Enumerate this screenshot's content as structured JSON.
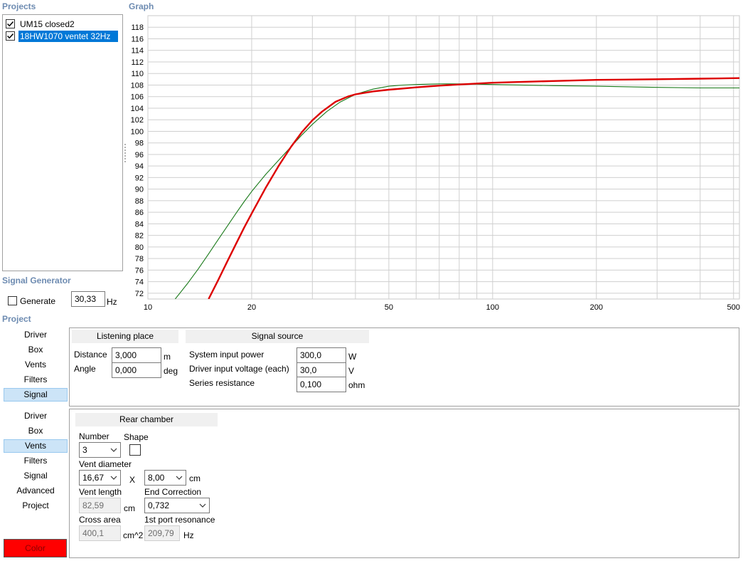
{
  "projects": {
    "title": "Projects",
    "items": [
      {
        "label": "UM15 closed2",
        "checked": true,
        "selected": false
      },
      {
        "label": "18HW1070 ventet 32Hz",
        "checked": true,
        "selected": true
      }
    ]
  },
  "graph": {
    "title": "Graph"
  },
  "signal_generator": {
    "title": "Signal Generator",
    "generate_label": "Generate",
    "generate_checked": false,
    "frequency": "30,33",
    "frequency_unit": "Hz"
  },
  "project": {
    "title": "Project",
    "nav1": [
      "Driver",
      "Box",
      "Vents",
      "Filters",
      "Signal"
    ],
    "nav1_active": "Signal",
    "nav2": [
      "Driver",
      "Box",
      "Vents",
      "Filters",
      "Signal",
      "Advanced",
      "Project"
    ],
    "nav2_active": "Vents",
    "color_button": "Color",
    "color_value": "#ff0000"
  },
  "listening_place": {
    "header": "Listening place",
    "distance_label": "Distance",
    "distance_value": "3,000",
    "distance_unit": "m",
    "angle_label": "Angle",
    "angle_value": "0,000",
    "angle_unit": "deg"
  },
  "signal_source": {
    "header": "Signal source",
    "power_label": "System input power",
    "power_value": "300,0",
    "power_unit": "W",
    "voltage_label": "Driver input voltage (each)",
    "voltage_value": "30,0",
    "voltage_unit": "V",
    "resistance_label": "Series resistance",
    "resistance_value": "0,100",
    "resistance_unit": "ohm"
  },
  "rear_chamber": {
    "header": "Rear chamber",
    "number_label": "Number",
    "number_value": "3",
    "shape_label": "Shape",
    "vent_diameter_label": "Vent diameter",
    "vent_diameter_1": "16,67",
    "x_label": "X",
    "vent_diameter_2": "8,00",
    "vent_diameter_unit": "cm",
    "vent_length_label": "Vent length",
    "vent_length_value": "82,59",
    "vent_length_unit": "cm",
    "end_correction_label": "End Correction",
    "end_correction_value": "0,732",
    "cross_area_label": "Cross area",
    "cross_area_value": "400,1",
    "cross_area_unit": "cm^2",
    "port_resonance_label": "1st port resonance",
    "port_resonance_value": "209,79",
    "port_resonance_unit": "Hz"
  },
  "chart_data": {
    "type": "line",
    "x_scale": "log",
    "xlim": [
      10,
      520
    ],
    "ylim": [
      71,
      120
    ],
    "grid": true,
    "x_ticks": [
      10,
      20,
      50,
      100,
      200,
      500
    ],
    "y_ticks": [
      72,
      74,
      76,
      78,
      80,
      82,
      84,
      86,
      88,
      90,
      92,
      94,
      96,
      98,
      100,
      102,
      104,
      106,
      108,
      110,
      112,
      114,
      116,
      118
    ],
    "series": [
      {
        "color": "#1a7a1a",
        "stroke": "thin",
        "x": [
          12,
          13,
          14,
          15,
          16,
          17,
          18,
          19,
          20,
          22,
          25,
          28,
          30,
          33,
          36,
          40,
          45,
          50,
          55,
          60,
          70,
          80,
          100,
          150,
          200,
          300,
          400,
          520
        ],
        "y": [
          71,
          73.6,
          76.2,
          78.8,
          81.3,
          83.6,
          85.8,
          87.8,
          89.6,
          92.6,
          96.2,
          99.4,
          101.2,
          103.4,
          105.0,
          106.4,
          107.3,
          107.8,
          108.0,
          108.1,
          108.2,
          108.2,
          108.1,
          107.9,
          107.8,
          107.6,
          107.5,
          107.5
        ]
      },
      {
        "color": "#dd0000",
        "stroke": "thick",
        "x": [
          15,
          16,
          17,
          18,
          19,
          20,
          22,
          24,
          26,
          28,
          30,
          32,
          35,
          38,
          40,
          45,
          50,
          55,
          60,
          70,
          80,
          100,
          150,
          200,
          300,
          400,
          520
        ],
        "y": [
          71,
          74.3,
          77.5,
          80.5,
          83.3,
          85.8,
          90.3,
          94.1,
          97.3,
          99.9,
          101.9,
          103.4,
          105.1,
          106.0,
          106.4,
          106.9,
          107.2,
          107.4,
          107.6,
          107.9,
          108.1,
          108.4,
          108.7,
          108.9,
          109.0,
          109.1,
          109.2
        ]
      }
    ]
  }
}
